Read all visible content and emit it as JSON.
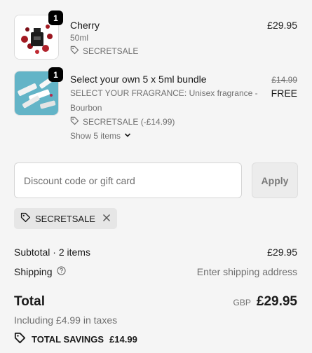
{
  "items": [
    {
      "quantity": "1",
      "name": "Cherry",
      "variant": "50ml",
      "discount": "SECRETSALE",
      "price": "£29.95"
    },
    {
      "quantity": "1",
      "name": "Select your own 5 x 5ml bundle",
      "variant_line1": "SELECT YOUR FRAGRANCE: Unisex fragrance -",
      "variant_line2": "Bourbon",
      "discount": "SECRETSALE (-£14.99)",
      "original_price": "£14.99",
      "price": "FREE",
      "show_items": "Show 5 items"
    }
  ],
  "discount": {
    "placeholder": "Discount code or gift card",
    "apply_label": "Apply",
    "applied_code": "SECRETSALE"
  },
  "summary": {
    "subtotal_label": "Subtotal · 2 items",
    "subtotal_value": "£29.95",
    "shipping_label": "Shipping",
    "shipping_value": "Enter shipping address",
    "total_label": "Total",
    "currency": "GBP",
    "total_value": "£29.95",
    "taxes_note": "Including £4.99 in taxes",
    "savings_label": "TOTAL SAVINGS",
    "savings_value": "£14.99"
  },
  "colors": {
    "background": "#f5f5f5",
    "badge": "#000000",
    "muted_text": "#707070"
  }
}
